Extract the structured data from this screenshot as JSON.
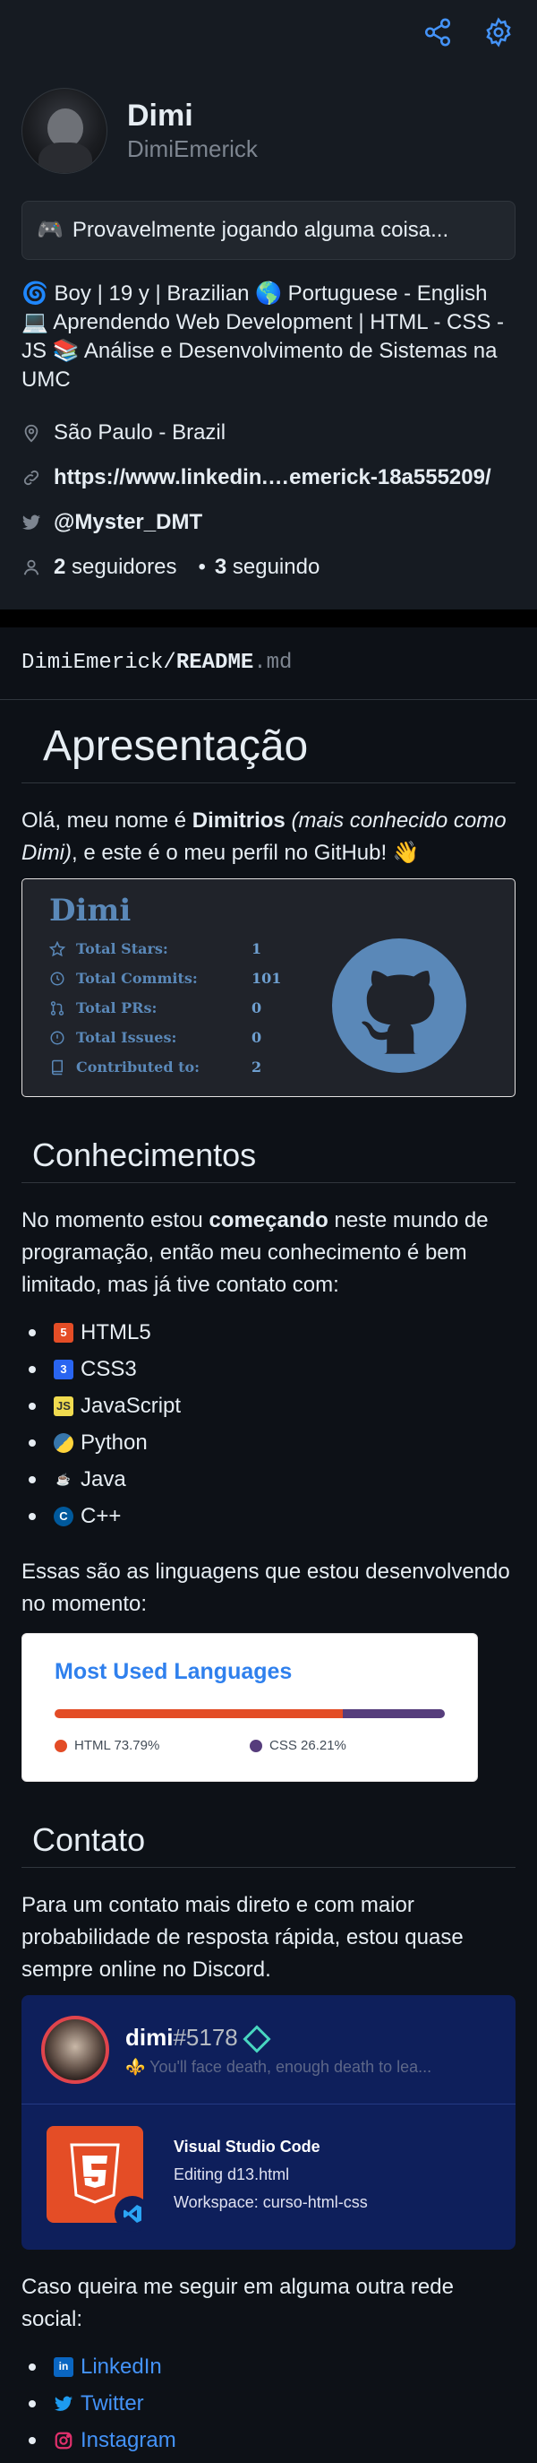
{
  "profile": {
    "name": "Dimi",
    "login": "DimiEmerick",
    "status": "Provavelmente jogando alguma coisa...",
    "status_emoji": "🎮",
    "bio_lines": [
      "🌀 Boy | 19 y | Brazilian 🌎 Portuguese - English",
      "💻 Aprendendo Web Development | HTML - CSS -",
      "JS 📚 Análise e Desenvolvimento de Sistemas na",
      "UMC"
    ],
    "location": "São Paulo - Brazil",
    "website": "https://www.linkedin.…emerick-18a555209/",
    "twitter": "@Myster_DMT",
    "followers_count": "2",
    "followers_label": "seguidores",
    "following_count": "3",
    "following_label": "seguindo"
  },
  "readme": {
    "path_user": "DimiEmerick/",
    "path_file": "README",
    "path_ext": ".md",
    "h1": "Apresentação",
    "intro_1": "Olá, meu nome é ",
    "intro_name": "Dimitrios",
    "intro_italic": "(mais conhecido como Dimi)",
    "intro_2": ", e este é o meu perfil no GitHub! 👋",
    "stats_card": {
      "name": "Dimi",
      "rows": [
        {
          "label": "Total Stars:",
          "value": "1"
        },
        {
          "label": "Total Commits:",
          "value": "101"
        },
        {
          "label": "Total PRs:",
          "value": "0"
        },
        {
          "label": "Total Issues:",
          "value": "0"
        },
        {
          "label": "Contributed to:",
          "value": "2"
        }
      ]
    },
    "h2_knowledge": "Conhecimentos",
    "knowledge_1": "No momento estou ",
    "knowledge_bold": "começando",
    "knowledge_2": " neste mundo de programação, então meu conhecimento é bem limitado, mas já tive contato com:",
    "skills": [
      {
        "label": "HTML5",
        "icon": "html5-icon",
        "glyph": "5",
        "color": "#e44d26"
      },
      {
        "label": "CSS3",
        "icon": "css3-icon",
        "glyph": "3",
        "color": "#2965f1"
      },
      {
        "label": "JavaScript",
        "icon": "javascript-icon",
        "glyph": "JS",
        "color": "#f0db4f"
      },
      {
        "label": "Python",
        "icon": "python-icon",
        "glyph": "Py",
        "color": "#3776ab"
      },
      {
        "label": "Java",
        "icon": "java-icon",
        "glyph": "J",
        "color": "#5b3b2e"
      },
      {
        "label": "C++",
        "icon": "cpp-icon",
        "glyph": "C",
        "color": "#00599c"
      }
    ],
    "langs_intro": "Essas são as linguagens que estou desenvolvendo no momento:",
    "langs_card": {
      "title": "Most Used Languages",
      "items": [
        {
          "name": "HTML",
          "percent": 73.79,
          "label": "HTML 73.79%",
          "color": "#e34c26"
        },
        {
          "name": "CSS",
          "percent": 26.21,
          "label": "CSS 26.21%",
          "color": "#563d7c"
        }
      ]
    },
    "h2_contact": "Contato",
    "contact_text": "Para um contato mais direto e com maior probabilidade de resposta rápida, estou quase sempre online no Discord.",
    "discord": {
      "username": "dimi",
      "discriminator": "#5178",
      "custom_status": "⚜️ You'll face death, enough death to lea...",
      "activity_app": "Visual Studio Code",
      "activity_details": "Editing d13.html",
      "activity_state": "Workspace: curso-html-css"
    },
    "social_intro": "Caso queira me seguir em alguma outra rede social:",
    "social": [
      {
        "label": "LinkedIn",
        "icon": "linkedin-icon",
        "glyph": "in",
        "color": "#0a66c2"
      },
      {
        "label": "Twitter",
        "icon": "twitter-icon",
        "glyph": "🐦",
        "color": "#1d9bf0"
      },
      {
        "label": "Instagram",
        "icon": "instagram-icon",
        "glyph": "◎",
        "color": "#e1306c"
      }
    ]
  },
  "colors": {
    "accent": "#4493f8",
    "page_bg": "#0d1117",
    "header_bg": "#161b22"
  }
}
